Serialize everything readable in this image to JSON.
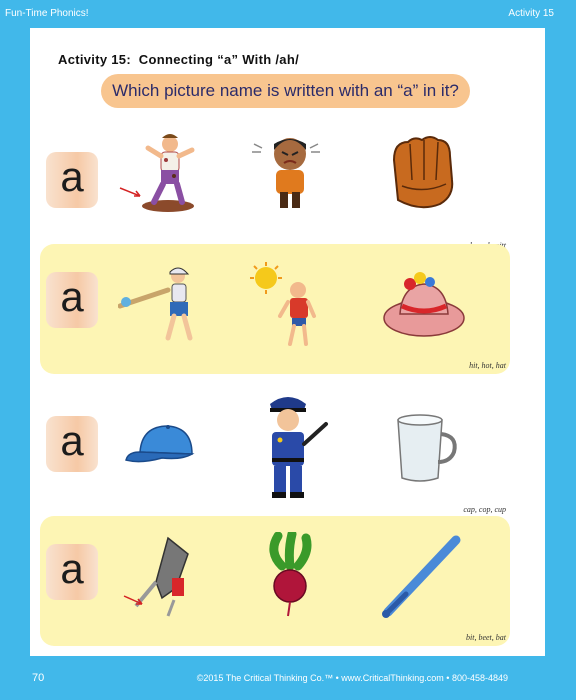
{
  "header": {
    "left": "Fun-Time Phonics!",
    "right": "Activity 15"
  },
  "activity_title": "Activity 15:  Connecting “a” With /ah/",
  "question": "Which picture name is written with an “a” in it?",
  "rows": [
    {
      "letter": "a",
      "hint": "mud, mad, mitt",
      "pictures": [
        "muddy-boy",
        "angry-boy",
        "baseball-mitt"
      ]
    },
    {
      "letter": "a",
      "hint": "hit, hot, hat",
      "pictures": [
        "batter-hitting",
        "hot-man-sun",
        "flowered-hat"
      ]
    },
    {
      "letter": "a",
      "hint": "cap, cop, cup",
      "pictures": [
        "blue-cap",
        "police-officer",
        "glass-cup"
      ]
    },
    {
      "letter": "a",
      "hint": "bit, beet, bat",
      "pictures": [
        "drill-bit",
        "beet",
        "baseball-bat"
      ]
    }
  ],
  "footer": {
    "page": "70",
    "copyright": "©2015 The Critical Thinking Co.™ • www.CriticalThinking.com • 800-458-4849"
  }
}
